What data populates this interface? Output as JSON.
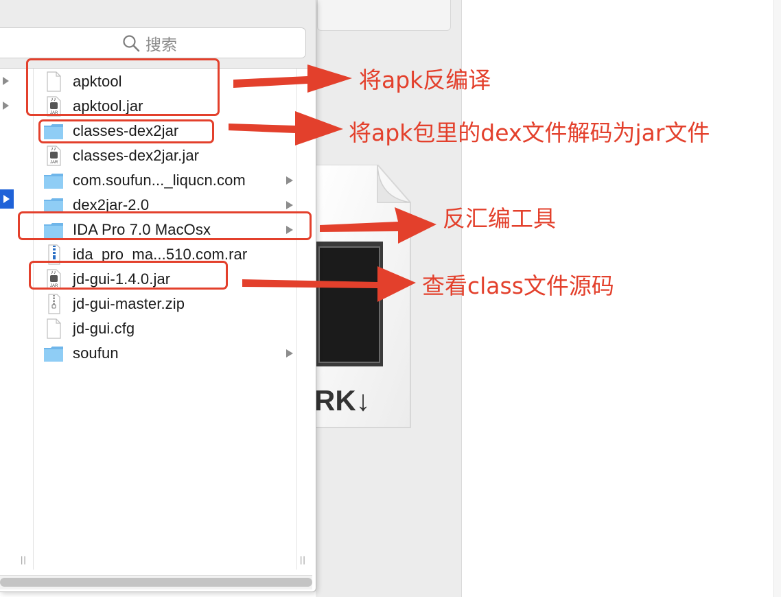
{
  "search": {
    "placeholder": "搜索"
  },
  "files": [
    {
      "name": "apktool",
      "type": "file",
      "has_children": false
    },
    {
      "name": "apktool.jar",
      "type": "jar",
      "has_children": false
    },
    {
      "name": "classes-dex2jar",
      "type": "folder",
      "has_children": false
    },
    {
      "name": "classes-dex2jar.jar",
      "type": "jar",
      "has_children": false
    },
    {
      "name": "com.soufun..._liqucn.com",
      "type": "folder",
      "has_children": true
    },
    {
      "name": "dex2jar-2.0",
      "type": "folder",
      "has_children": true
    },
    {
      "name": "IDA Pro 7.0 MacOsx",
      "type": "folder",
      "has_children": true
    },
    {
      "name": "ida_pro_ma...510.com.rar",
      "type": "archive",
      "has_children": false
    },
    {
      "name": "jd-gui-1.4.0.jar",
      "type": "jar",
      "has_children": false
    },
    {
      "name": "jd-gui-master.zip",
      "type": "zip",
      "has_children": false
    },
    {
      "name": "jd-gui.cfg",
      "type": "file",
      "has_children": false
    },
    {
      "name": "soufun",
      "type": "folder",
      "has_children": true
    }
  ],
  "preview": {
    "label": "RK↓"
  },
  "annotations": {
    "apktool": "将apk反编译",
    "dex2jar": "将apk包里的dex文件解码为jar文件",
    "ida": "反汇编工具",
    "jdgui": "查看class文件源码"
  },
  "colors": {
    "annotation": "#e3402c",
    "selection": "#1f62d8",
    "folder": "#7fc3f2"
  }
}
